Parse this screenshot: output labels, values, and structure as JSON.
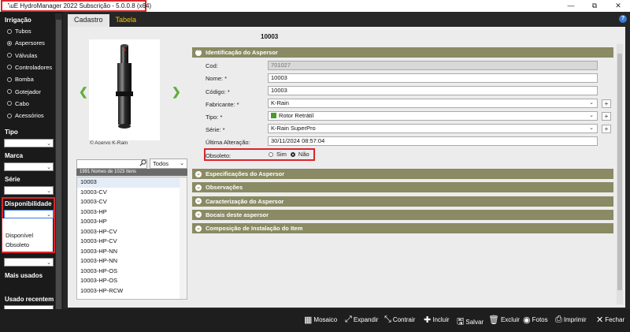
{
  "window": {
    "title": "AuE HydroManager 2022 Subscrição - 5.0.0.8 (x64)",
    "controls": [
      "—",
      "⧉",
      "✕"
    ]
  },
  "sidebar": {
    "irrigacao_title": "Irrigação",
    "irrigacao_items": [
      {
        "label": "Tubos",
        "selected": false
      },
      {
        "label": "Aspersores",
        "selected": true
      },
      {
        "label": "Válvulas",
        "selected": false
      },
      {
        "label": "Controladores",
        "selected": false
      },
      {
        "label": "Bomba",
        "selected": false
      },
      {
        "label": "Gotejador",
        "selected": false
      },
      {
        "label": "Cabo",
        "selected": false
      },
      {
        "label": "Acessórios",
        "selected": false
      }
    ],
    "filters": {
      "tipo": "Tipo",
      "marca": "Marca",
      "serie": "Série",
      "disponibilidade": "Disponibilidade",
      "mais_usados": "Mais usados",
      "usado_recentem": "Usado recentem"
    },
    "disponibilidade_options": [
      "Disponível",
      "Obsoleto"
    ]
  },
  "tabs": {
    "cadastro": "Cadastro",
    "tabela": "Tabela"
  },
  "record": {
    "code": "10003",
    "photo_credit": "© Acervo K-Rain"
  },
  "list_panel": {
    "filter_value": "Todos",
    "count_text": "1991 Nomes de 1023 Itens",
    "items": [
      "10003",
      "10003-CV",
      "10003-CV",
      "10003-HP",
      "10003-HP",
      "10003-HP-CV",
      "10003-HP-CV",
      "10003-HP-NN",
      "10003-HP-NN",
      "10003-HP-OS",
      "10003-HP-OS",
      "10003-HP-RCW"
    ]
  },
  "form": {
    "section_identificacao": "Identificação do Aspersor",
    "fields": {
      "cod_label": "Cod:",
      "cod_value": "701027",
      "nome_label": "Nome: *",
      "nome_value": "10003",
      "codigo_label": "Código: *",
      "codigo_value": "10003",
      "fabricante_label": "Fabricante: *",
      "fabricante_value": "K-Rain",
      "tipo_label": "Tipo: *",
      "tipo_value": "Rotor Retrátil",
      "serie_label": "Série: *",
      "serie_value": "K-Rain SuperPro",
      "ultima_label": "Última Alteração:",
      "ultima_value": "30/11/2024 08:57:04",
      "obsoleto_label": "Obsoleto:",
      "sim": "Sim",
      "nao": "Não"
    },
    "plus": "+",
    "sections": [
      "Especificações do Aspersor",
      "Observações",
      "Caracterização do Aspersor",
      "Bocais deste aspersor",
      "Composição de Instalação do Item"
    ]
  },
  "toolbar": {
    "mosaico": "Mosaico",
    "expandir": "Expandir",
    "contrair": "Contrair",
    "incluir": "Incluir",
    "salvar": "Salvar",
    "excluir": "Excluir",
    "fotos": "Fotos",
    "imprimir": "Imprimir",
    "fechar": "Fechar"
  },
  "colors": {
    "accent_red": "#d9262b",
    "section_header": "#8a8a64",
    "tab_active": "#f2c200"
  }
}
